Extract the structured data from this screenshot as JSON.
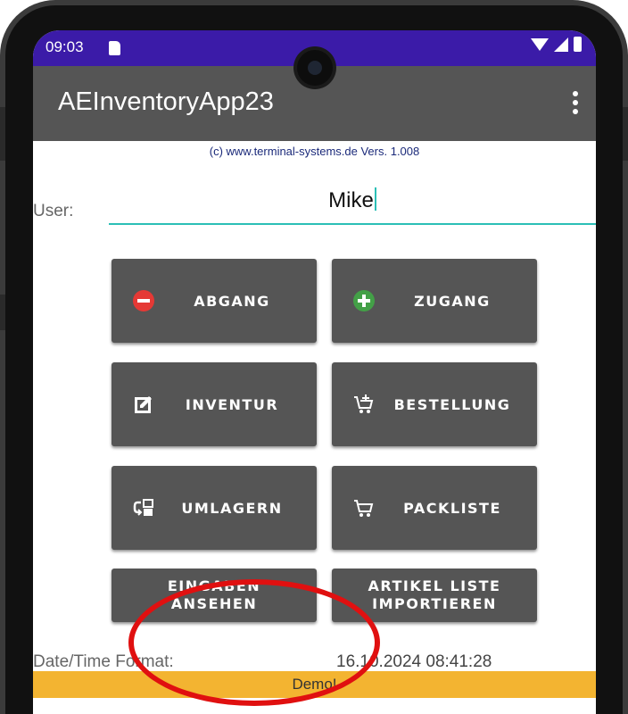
{
  "status_bar": {
    "time": "09:03"
  },
  "app_bar": {
    "title": "AEInventoryApp23"
  },
  "copyright": "(c) www.terminal-systems.de Vers. 1.008",
  "user": {
    "label": "User:",
    "value": "Mike"
  },
  "buttons": {
    "abgang": "ABGANG",
    "zugang": "ZUGANG",
    "inventur": "INVENTUR",
    "bestellung": "BESTELLUNG",
    "umlagern": "UMLAGERN",
    "packliste": "PACKLISTE",
    "eingaben_1": "EINGABEN",
    "eingaben_2": "ANSEHEN",
    "artikel_1": "ARTIKEL LISTE",
    "artikel_2": "IMPORTIEREN"
  },
  "date_time": {
    "label": "Date/Time Format:",
    "value": "16.10.2024 08:41:28"
  },
  "banner": "Demo!",
  "colors": {
    "status_bar": "#3b1ba8",
    "app_bar": "#555555",
    "button": "#555555",
    "accent": "#2bbfb6",
    "demo_banner": "#f3b431",
    "annotation": "#e01010"
  },
  "icons": [
    "sd-card-icon",
    "wifi-icon",
    "signal-icon",
    "battery-icon",
    "overflow-menu-icon",
    "minus-circle-icon",
    "plus-circle-icon",
    "edit-icon",
    "cart-add-icon",
    "transfer-icon",
    "cart-icon"
  ]
}
